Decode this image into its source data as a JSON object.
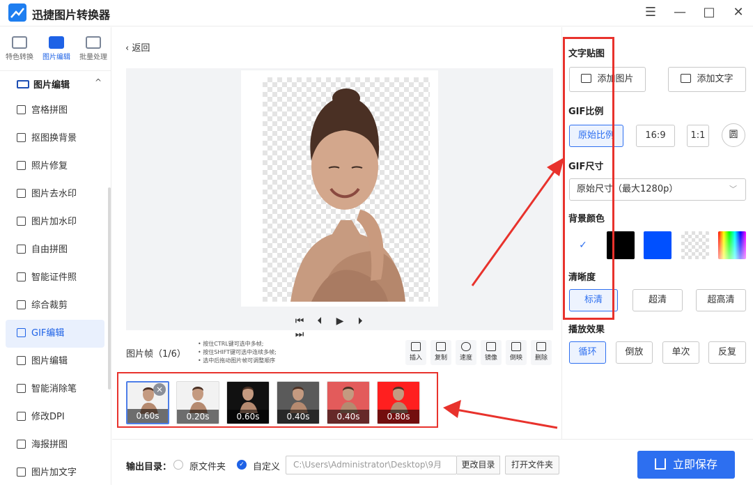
{
  "app": {
    "title": "迅捷图片转换器"
  },
  "window_controls": {
    "menu": "☰",
    "minimize": "—",
    "maximize": "□",
    "close": "✕"
  },
  "sidebar": {
    "top_nav": [
      {
        "label": "特色转换",
        "icon": "convert-icon",
        "active": false
      },
      {
        "label": "图片编辑",
        "icon": "image-edit-icon",
        "active": true
      },
      {
        "label": "批量处理",
        "icon": "batch-icon",
        "active": false
      }
    ],
    "section_title": "图片编辑",
    "section_caret": "^",
    "items": [
      {
        "label": "宫格拼图",
        "icon": "grid-icon"
      },
      {
        "label": "抠图换背景",
        "icon": "cutout-icon"
      },
      {
        "label": "照片修复",
        "icon": "photo-repair-icon"
      },
      {
        "label": "图片去水印",
        "icon": "remove-watermark-icon"
      },
      {
        "label": "图片加水印",
        "icon": "add-watermark-icon"
      },
      {
        "label": "自由拼图",
        "icon": "collage-icon"
      },
      {
        "label": "智能证件照",
        "icon": "id-photo-icon"
      },
      {
        "label": "综合裁剪",
        "icon": "crop-icon"
      },
      {
        "label": "GIF编辑",
        "icon": "gif-icon",
        "active": true
      },
      {
        "label": "图片编辑",
        "icon": "image-edit-icon"
      },
      {
        "label": "智能消除笔",
        "icon": "eraser-icon"
      },
      {
        "label": "修改DPI",
        "icon": "dpi-icon"
      },
      {
        "label": "海报拼图",
        "icon": "poster-icon"
      },
      {
        "label": "图片加文字",
        "icon": "add-text-icon"
      }
    ]
  },
  "main": {
    "back_label": "返回",
    "playback": {
      "first": "⏮",
      "prev": "⏴",
      "play": "▶",
      "next": "⏵",
      "last": "⏭"
    },
    "frames_label": "图片帧（1/6）",
    "hints": [
      "按住CTRL键可选中多帧;",
      "按住SHIFT键可选中连续多帧;",
      "选中后拖动图片帧可调整顺序"
    ],
    "tools": [
      {
        "label": "插入",
        "icon": "insert-icon"
      },
      {
        "label": "复制",
        "icon": "copy-icon"
      },
      {
        "label": "速度",
        "icon": "speed-icon"
      },
      {
        "label": "镜像",
        "icon": "mirror-icon"
      },
      {
        "label": "倒映",
        "icon": "reflect-icon"
      },
      {
        "label": "删除",
        "icon": "delete-icon"
      }
    ],
    "frames": [
      {
        "duration": "0.60s",
        "bg": "#f2f2f2"
      },
      {
        "duration": "0.20s",
        "bg": "#f2f2f2"
      },
      {
        "duration": "0.60s",
        "bg": "#111111"
      },
      {
        "duration": "0.40s",
        "bg": "#5a5a5a"
      },
      {
        "duration": "0.40s",
        "bg": "#e35b5b"
      },
      {
        "duration": "0.80s",
        "bg": "#ff1f1f"
      }
    ],
    "frame_close": "×"
  },
  "bottom": {
    "output_label": "输出目录：",
    "option_original": "原文件夹",
    "option_custom": "自定义",
    "path": "C:\\Users\\Administrator\\Desktop\\9月",
    "change_dir": "更改目录",
    "open_dir": "打开文件夹",
    "save": "立即保存"
  },
  "panel": {
    "sticker_title": "文字贴图",
    "add_image": "添加图片",
    "add_text": "添加文字",
    "ratio_title": "GIF比例",
    "ratios": [
      "原始比例",
      "16:9",
      "1:1",
      "圆"
    ],
    "size_title": "GIF尺寸",
    "size_value": "原始尺寸（最大1280p）",
    "bg_title": "背景颜色",
    "bg_colors": [
      "#ffffff",
      "#000000",
      "#0050ff",
      "transparent",
      "rainbow"
    ],
    "clarity_title": "清晰度",
    "clarity": [
      "标清",
      "超清",
      "超高清"
    ],
    "play_title": "播放效果",
    "play_modes": [
      "循环",
      "倒放",
      "单次",
      "反复"
    ]
  },
  "colors": {
    "accent": "#2d6ff0",
    "annotation": "#e8322c"
  }
}
